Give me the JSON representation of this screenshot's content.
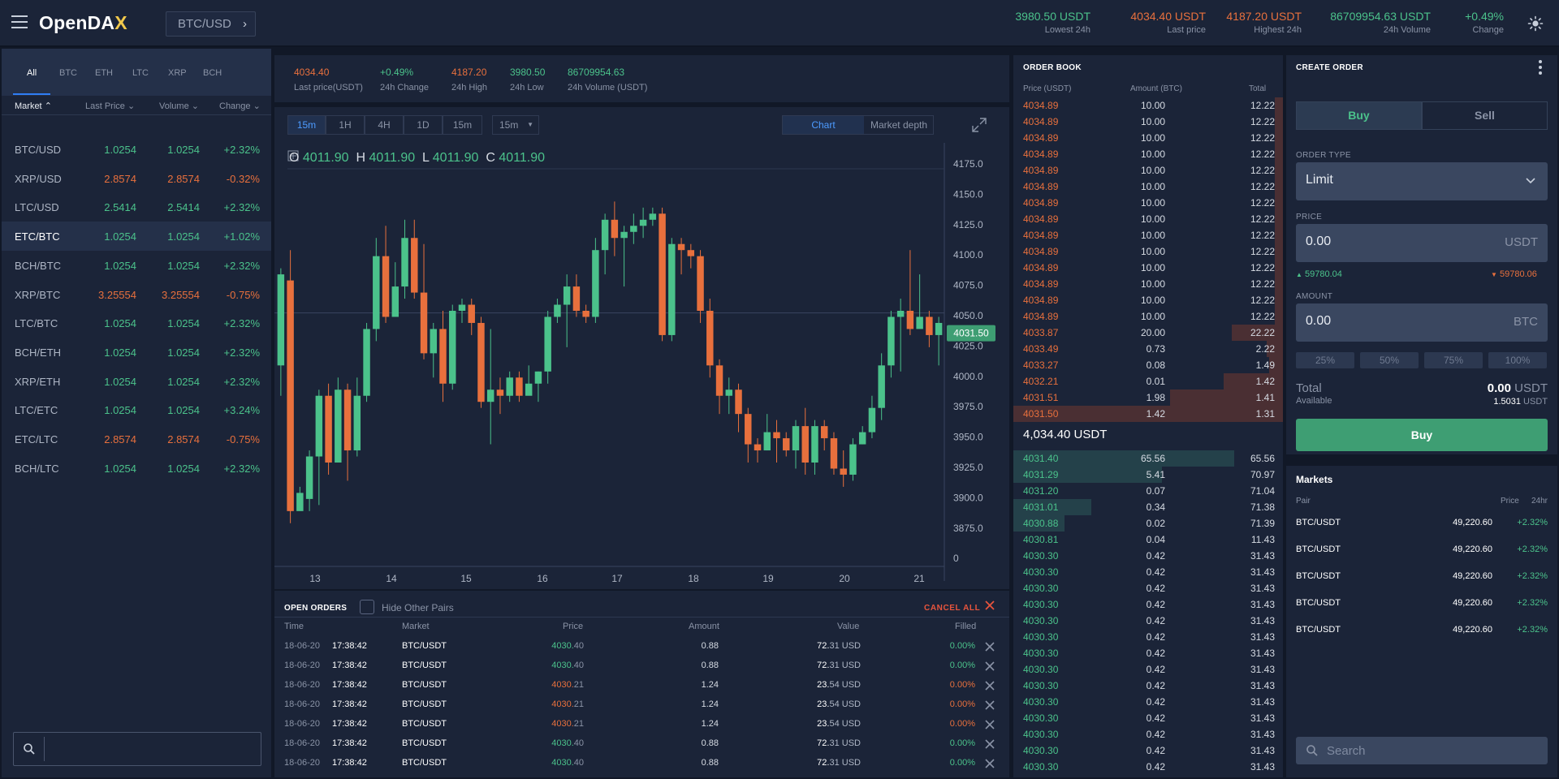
{
  "header": {
    "logo_main": "OpenDA",
    "logo_x": "X",
    "pair": "BTC/USD",
    "stats": [
      {
        "value": "3980.50 USDT",
        "label": "Lowest 24h",
        "color": "green",
        "right": 1343
      },
      {
        "value": "4034.40 USDT",
        "label": "Last price",
        "color": "red",
        "right": 1485
      },
      {
        "value": "4187.20 USDT",
        "label": "Highest 24h",
        "color": "red",
        "right": 1603
      },
      {
        "value": "86709954.63 USDT",
        "label": "24h Volume",
        "color": "green",
        "right": 1762
      },
      {
        "value": "+0.49%",
        "label": "Change",
        "color": "green",
        "right": 1852
      }
    ]
  },
  "left": {
    "tabs": [
      "All",
      "BTC",
      "ETH",
      "LTC",
      "XRP",
      "BCH"
    ],
    "headers": {
      "market": "Market",
      "last_price": "Last Price",
      "volume": "Volume",
      "change": "Change"
    },
    "rows": [
      {
        "pair": "BTC/USD",
        "last": "1.0254",
        "volume": "1.0254",
        "change": "+2.32%",
        "dir": "up"
      },
      {
        "pair": "XRP/USD",
        "last": "2.8574",
        "volume": "2.8574",
        "change": "-0.32%",
        "dir": "down"
      },
      {
        "pair": "LTC/USD",
        "last": "2.5414",
        "volume": "2.5414",
        "change": "+2.32%",
        "dir": "up"
      },
      {
        "pair": "ETC/BTC",
        "last": "1.0254",
        "volume": "1.0254",
        "change": "+1.02%",
        "dir": "up"
      },
      {
        "pair": "BCH/BTC",
        "last": "1.0254",
        "volume": "1.0254",
        "change": "+2.32%",
        "dir": "up"
      },
      {
        "pair": "XRP/BTC",
        "last": "3.25554",
        "volume": "3.25554",
        "change": "-0.75%",
        "dir": "down"
      },
      {
        "pair": "LTC/BTC",
        "last": "1.0254",
        "volume": "1.0254",
        "change": "+2.32%",
        "dir": "up"
      },
      {
        "pair": "BCH/ETH",
        "last": "1.0254",
        "volume": "1.0254",
        "change": "+2.32%",
        "dir": "up"
      },
      {
        "pair": "XRP/ETH",
        "last": "1.0254",
        "volume": "1.0254",
        "change": "+2.32%",
        "dir": "up"
      },
      {
        "pair": "LTC/ETC",
        "last": "1.0254",
        "volume": "1.0254",
        "change": "+3.24%",
        "dir": "up"
      },
      {
        "pair": "ETC/LTC",
        "last": "2.8574",
        "volume": "2.8574",
        "change": "-0.75%",
        "dir": "down"
      },
      {
        "pair": "BCH/LTC",
        "last": "1.0254",
        "volume": "1.0254",
        "change": "+2.32%",
        "dir": "up"
      }
    ],
    "search_value": ""
  },
  "ticker": [
    {
      "value": "4034.40",
      "label": "Last price(USDT)",
      "color": "red",
      "left": 24
    },
    {
      "value": "+0.49%",
      "label": "24h Change",
      "color": "green",
      "left": 130
    },
    {
      "value": "4187.20",
      "label": "24h High",
      "color": "red",
      "left": 218
    },
    {
      "value": "3980.50",
      "label": "24h Low",
      "color": "green",
      "left": 290
    },
    {
      "value": "86709954.63",
      "label": "24h Volume (USDT)",
      "color": "green",
      "left": 361
    }
  ],
  "chart": {
    "timeframes": [
      "15m",
      "1H",
      "4H",
      "1D",
      "15m"
    ],
    "interval_select": "15m",
    "toggle": {
      "chart": "Chart",
      "depth": "Market depth"
    },
    "ohlc": {
      "o_label": "O",
      "o": "4011.90",
      "h_label": "H",
      "h": "4011.90",
      "l_label": "L",
      "l": "4011.90",
      "c_label": "C",
      "c": "4011.90"
    },
    "current_price": "4031.50"
  },
  "chart_data": {
    "type": "candlestick",
    "title": "",
    "xlabel": "",
    "ylabel": "",
    "x_ticks": [
      "13",
      "14",
      "15",
      "16",
      "17",
      "18",
      "19",
      "20",
      "21"
    ],
    "y_ticks": [
      "4175.0",
      "4150.0",
      "4125.0",
      "4100.0",
      "4075.0",
      "4050.0",
      "4025.0",
      "4000.0",
      "3975.0",
      "3950.0",
      "3925.0",
      "3900.0",
      "3875.0",
      "0"
    ],
    "current_price": 4031.5,
    "candles": [
      [
        4005,
        4085,
        3980,
        4080
      ],
      [
        4075,
        4100,
        3875,
        3885
      ],
      [
        3885,
        3905,
        3895,
        3900
      ],
      [
        3895,
        3935,
        3885,
        3930
      ],
      [
        3930,
        3985,
        3890,
        3980
      ],
      [
        3980,
        3990,
        3915,
        3925
      ],
      [
        3925,
        3995,
        3950,
        3985
      ],
      [
        3985,
        3990,
        3910,
        3935
      ],
      [
        3935,
        3995,
        3930,
        3980
      ],
      [
        3980,
        4040,
        3975,
        4035
      ],
      [
        4035,
        4110,
        4025,
        4095
      ],
      [
        4095,
        4120,
        4040,
        4045
      ],
      [
        4045,
        4090,
        4050,
        4070
      ],
      [
        4070,
        4125,
        4060,
        4110
      ],
      [
        4110,
        4125,
        4060,
        4065
      ],
      [
        4065,
        4105,
        4010,
        4015
      ],
      [
        4015,
        4040,
        3995,
        4035
      ],
      [
        4035,
        4050,
        3975,
        3990
      ],
      [
        3990,
        4055,
        3985,
        4050
      ],
      [
        4050,
        4060,
        4040,
        4055
      ],
      [
        4055,
        4060,
        4030,
        4040
      ],
      [
        4040,
        4045,
        3970,
        3975
      ],
      [
        3975,
        4035,
        3940,
        3985
      ],
      [
        3985,
        3995,
        3965,
        3980
      ],
      [
        3980,
        4000,
        3975,
        3995
      ],
      [
        3995,
        4000,
        3975,
        3980
      ],
      [
        3980,
        4005,
        3985,
        3990
      ],
      [
        3990,
        4000,
        3975,
        4000
      ],
      [
        4000,
        4050,
        3990,
        4045
      ],
      [
        4045,
        4060,
        4040,
        4055
      ],
      [
        4055,
        4080,
        4020,
        4070
      ],
      [
        4070,
        4080,
        4045,
        4050
      ],
      [
        4050,
        4055,
        4040,
        4045
      ],
      [
        4045,
        4110,
        4040,
        4100
      ],
      [
        4100,
        4130,
        4080,
        4125
      ],
      [
        4125,
        4140,
        4095,
        4110
      ],
      [
        4110,
        4120,
        4070,
        4115
      ],
      [
        4115,
        4130,
        4105,
        4120
      ],
      [
        4120,
        4135,
        4110,
        4125
      ],
      [
        4125,
        4135,
        4120,
        4130
      ],
      [
        4130,
        4135,
        4025,
        4030
      ],
      [
        4030,
        4110,
        4025,
        4105
      ],
      [
        4105,
        4110,
        4080,
        4100
      ],
      [
        4100,
        4105,
        4085,
        4095
      ],
      [
        4095,
        4100,
        4040,
        4050
      ],
      [
        4050,
        4060,
        3995,
        4005
      ],
      [
        4005,
        4010,
        3965,
        3980
      ],
      [
        3980,
        3995,
        3965,
        3985
      ],
      [
        3985,
        3990,
        3950,
        3965
      ],
      [
        3965,
        3970,
        3925,
        3940
      ],
      [
        3940,
        3945,
        3925,
        3935
      ],
      [
        3935,
        3965,
        3935,
        3950
      ],
      [
        3950,
        3960,
        3925,
        3945
      ],
      [
        3945,
        3950,
        3930,
        3935
      ],
      [
        3935,
        3960,
        3920,
        3955
      ],
      [
        3955,
        3970,
        3915,
        3925
      ],
      [
        3925,
        3960,
        3915,
        3955
      ],
      [
        3955,
        3960,
        3935,
        3945
      ],
      [
        3945,
        3950,
        3915,
        3920
      ],
      [
        3920,
        3935,
        3905,
        3915
      ],
      [
        3915,
        3945,
        3910,
        3940
      ],
      [
        3940,
        3955,
        3940,
        3950
      ],
      [
        3950,
        3980,
        3945,
        3970
      ],
      [
        3970,
        4015,
        3960,
        4005
      ],
      [
        4005,
        4050,
        3995,
        4045
      ],
      [
        4045,
        4060,
        4000,
        4050
      ],
      [
        4050,
        4100,
        4030,
        4035
      ],
      [
        4035,
        4080,
        4040,
        4045
      ],
      [
        4045,
        4050,
        4020,
        4030
      ],
      [
        4030,
        4045,
        4005,
        4040
      ]
    ]
  },
  "orders": {
    "title": "OPEN ORDERS",
    "hide_label": "Hide Other Pairs",
    "cancel_all": "CANCEL ALL",
    "headers": {
      "time": "Time",
      "market": "Market",
      "price": "Price",
      "amount": "Amount",
      "value": "Value",
      "filled": "Filled"
    },
    "rows": [
      {
        "date": "18-06-20",
        "time": "17:38:42",
        "market": "BTC/USDT",
        "price_int": "4030.",
        "price_dec": "40",
        "amount": "0.88",
        "value_int": "72.",
        "value_dec": "31 USD",
        "filled": "0.00%",
        "side": "buy"
      },
      {
        "date": "18-06-20",
        "time": "17:38:42",
        "market": "BTC/USDT",
        "price_int": "4030.",
        "price_dec": "40",
        "amount": "0.88",
        "value_int": "72.",
        "value_dec": "31 USD",
        "filled": "0.00%",
        "side": "buy"
      },
      {
        "date": "18-06-20",
        "time": "17:38:42",
        "market": "BTC/USDT",
        "price_int": "4030.",
        "price_dec": "21",
        "amount": "1.24",
        "value_int": "23.",
        "value_dec": "54 USD",
        "filled": "0.00%",
        "side": "sell"
      },
      {
        "date": "18-06-20",
        "time": "17:38:42",
        "market": "BTC/USDT",
        "price_int": "4030.",
        "price_dec": "21",
        "amount": "1.24",
        "value_int": "23.",
        "value_dec": "54 USD",
        "filled": "0.00%",
        "side": "sell"
      },
      {
        "date": "18-06-20",
        "time": "17:38:42",
        "market": "BTC/USDT",
        "price_int": "4030.",
        "price_dec": "21",
        "amount": "1.24",
        "value_int": "23.",
        "value_dec": "54 USD",
        "filled": "0.00%",
        "side": "sell"
      },
      {
        "date": "18-06-20",
        "time": "17:38:42",
        "market": "BTC/USDT",
        "price_int": "4030.",
        "price_dec": "40",
        "amount": "0.88",
        "value_int": "72.",
        "value_dec": "31 USD",
        "filled": "0.00%",
        "side": "buy"
      },
      {
        "date": "18-06-20",
        "time": "17:38:42",
        "market": "BTC/USDT",
        "price_int": "4030.",
        "price_dec": "40",
        "amount": "0.88",
        "value_int": "72.",
        "value_dec": "31 USD",
        "filled": "0.00%",
        "side": "buy"
      }
    ]
  },
  "book": {
    "title": "ORDER BOOK",
    "headers": {
      "price": "Price (USDT)",
      "amount": "Amount (BTC)",
      "total": "Total"
    },
    "asks": [
      {
        "price": "4034.89",
        "amount": "10.00",
        "total": "12.22",
        "depth": 0.03
      },
      {
        "price": "4034.89",
        "amount": "10.00",
        "total": "12.22",
        "depth": 0.03
      },
      {
        "price": "4034.89",
        "amount": "10.00",
        "total": "12.22",
        "depth": 0.03
      },
      {
        "price": "4034.89",
        "amount": "10.00",
        "total": "12.22",
        "depth": 0.03
      },
      {
        "price": "4034.89",
        "amount": "10.00",
        "total": "12.22",
        "depth": 0.03
      },
      {
        "price": "4034.89",
        "amount": "10.00",
        "total": "12.22",
        "depth": 0.03
      },
      {
        "price": "4034.89",
        "amount": "10.00",
        "total": "12.22",
        "depth": 0.03
      },
      {
        "price": "4034.89",
        "amount": "10.00",
        "total": "12.22",
        "depth": 0.03
      },
      {
        "price": "4034.89",
        "amount": "10.00",
        "total": "12.22",
        "depth": 0.03
      },
      {
        "price": "4034.89",
        "amount": "10.00",
        "total": "12.22",
        "depth": 0.03
      },
      {
        "price": "4034.89",
        "amount": "10.00",
        "total": "12.22",
        "depth": 0.03
      },
      {
        "price": "4034.89",
        "amount": "10.00",
        "total": "12.22",
        "depth": 0.03
      },
      {
        "price": "4034.89",
        "amount": "10.00",
        "total": "12.22",
        "depth": 0.03
      },
      {
        "price": "4034.89",
        "amount": "10.00",
        "total": "12.22",
        "depth": 0.03
      },
      {
        "price": "4033.87",
        "amount": "20.00",
        "total": "22.22",
        "depth": 0.19
      },
      {
        "price": "4033.49",
        "amount": "0.73",
        "total": "2.22",
        "depth": 0.06
      },
      {
        "price": "4033.27",
        "amount": "0.08",
        "total": "1.49",
        "depth": 0.05
      },
      {
        "price": "4032.21",
        "amount": "0.01",
        "total": "1.42",
        "depth": 0.22
      },
      {
        "price": "4031.51",
        "amount": "1.98",
        "total": "1.41",
        "depth": 0.42
      },
      {
        "price": "4031.50",
        "amount": "1.42",
        "total": "1.31",
        "depth": 1.0
      }
    ],
    "mid": "4,034.40 USDT",
    "bids": [
      {
        "price": "4031.40",
        "amount": "65.56",
        "total": "65.56",
        "depth": 0.82
      },
      {
        "price": "4031.29",
        "amount": "5.41",
        "total": "70.97",
        "depth": 0.55
      },
      {
        "price": "4031.20",
        "amount": "0.07",
        "total": "71.04",
        "depth": 0.0
      },
      {
        "price": "4031.01",
        "amount": "0.34",
        "total": "71.38",
        "depth": 0.29
      },
      {
        "price": "4030.88",
        "amount": "0.02",
        "total": "71.39",
        "depth": 0.19
      },
      {
        "price": "4030.81",
        "amount": "0.04",
        "total": "11.43",
        "depth": 0.0
      },
      {
        "price": "4030.30",
        "amount": "0.42",
        "total": "31.43",
        "depth": 0.0
      },
      {
        "price": "4030.30",
        "amount": "0.42",
        "total": "31.43",
        "depth": 0.0
      },
      {
        "price": "4030.30",
        "amount": "0.42",
        "total": "31.43",
        "depth": 0.0
      },
      {
        "price": "4030.30",
        "amount": "0.42",
        "total": "31.43",
        "depth": 0.0
      },
      {
        "price": "4030.30",
        "amount": "0.42",
        "total": "31.43",
        "depth": 0.0
      },
      {
        "price": "4030.30",
        "amount": "0.42",
        "total": "31.43",
        "depth": 0.0
      },
      {
        "price": "4030.30",
        "amount": "0.42",
        "total": "31.43",
        "depth": 0.0
      },
      {
        "price": "4030.30",
        "amount": "0.42",
        "total": "31.43",
        "depth": 0.0
      },
      {
        "price": "4030.30",
        "amount": "0.42",
        "total": "31.43",
        "depth": 0.0
      },
      {
        "price": "4030.30",
        "amount": "0.42",
        "total": "31.43",
        "depth": 0.0
      },
      {
        "price": "4030.30",
        "amount": "0.42",
        "total": "31.43",
        "depth": 0.0
      },
      {
        "price": "4030.30",
        "amount": "0.42",
        "total": "31.43",
        "depth": 0.0
      },
      {
        "price": "4030.30",
        "amount": "0.42",
        "total": "31.43",
        "depth": 0.0
      },
      {
        "price": "4030.30",
        "amount": "0.42",
        "total": "31.43",
        "depth": 0.0
      }
    ]
  },
  "create": {
    "title": "CREATE ORDER",
    "buy_tab": "Buy",
    "sell_tab": "Sell",
    "order_type_label": "ORDER TYPE",
    "order_type": "Limit",
    "price_label": "PRICE",
    "price_value": "0.00",
    "price_unit": "USDT",
    "price_up": "59780.04",
    "price_down": "59780.06",
    "amount_label": "AMOUNT",
    "amount_value": "0.00",
    "amount_unit": "BTC",
    "pcts": [
      "25%",
      "50%",
      "75%",
      "100%"
    ],
    "total_label": "Total",
    "total_value": "0.00",
    "total_unit": "USDT",
    "available_label": "Available",
    "available_value": "1.5031",
    "available_unit": "USDT",
    "submit": "Buy"
  },
  "markets": {
    "title": "Markets",
    "headers": {
      "pair": "Pair",
      "price": "Price",
      "change": "24hr"
    },
    "rows": [
      {
        "pair": "BTC/USDT",
        "price": "49,220.60",
        "change": "+2.32%"
      },
      {
        "pair": "BTC/USDT",
        "price": "49,220.60",
        "change": "+2.32%"
      },
      {
        "pair": "BTC/USDT",
        "price": "49,220.60",
        "change": "+2.32%"
      },
      {
        "pair": "BTC/USDT",
        "price": "49,220.60",
        "change": "+2.32%"
      },
      {
        "pair": "BTC/USDT",
        "price": "49,220.60",
        "change": "+2.32%"
      }
    ],
    "search_placeholder": "Search"
  },
  "colors": {
    "green": "#4bc28b",
    "red": "#e8703d",
    "accent": "#2f7ef5"
  }
}
